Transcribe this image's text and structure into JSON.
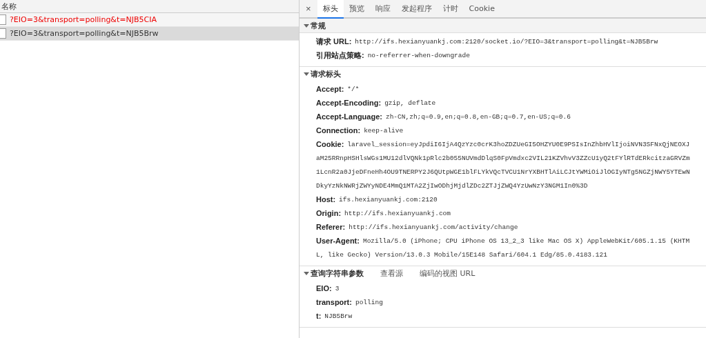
{
  "requests": {
    "column_header": "名称",
    "rows": [
      {
        "name": "?EIO=3&transport=polling&t=NJB5CIA",
        "failed": true,
        "selected": false
      },
      {
        "name": "?EIO=3&transport=polling&t=NJB5Brw",
        "failed": false,
        "selected": true
      }
    ]
  },
  "detail": {
    "close": "×",
    "tabs": [
      {
        "label": "标头",
        "selected": true
      },
      {
        "label": "预览",
        "selected": false
      },
      {
        "label": "响应",
        "selected": false
      },
      {
        "label": "发起程序",
        "selected": false
      },
      {
        "label": "计时",
        "selected": false
      },
      {
        "label": "Cookie",
        "selected": false
      }
    ],
    "sections": [
      {
        "title": "常规",
        "expanded": true,
        "header_bg": true,
        "entries": [
          {
            "key": "请求 URL:",
            "lines": [
              "http://ifs.hexianyuankj.com:2120/socket.io/?EIO=3&transport=polling&t=NJB5Brw"
            ]
          },
          {
            "key": "引用站点策略:",
            "lines": [
              "no-referrer-when-downgrade"
            ]
          }
        ]
      },
      {
        "title": "请求标头",
        "expanded": true,
        "header_bg": false,
        "entries": [
          {
            "key": "Accept:",
            "lines": [
              "*/*"
            ]
          },
          {
            "key": "Accept-Encoding:",
            "lines": [
              "gzip, deflate"
            ]
          },
          {
            "key": "Accept-Language:",
            "lines": [
              "zh-CN,zh;q=0.9,en;q=0.8,en-GB;q=0.7,en-US;q=0.6"
            ]
          },
          {
            "key": "Connection:",
            "lines": [
              "keep-alive"
            ]
          },
          {
            "key": "Cookie:",
            "lines": [
              "laravel_session=eyJpdiI6IjA4QzYzc0crK3hoZDZUeGI5OHZYU0E9PSIsInZhbHVlIjoiNVN3SFNxQjNEOXJ",
              "aM25RRnpHSHlsWGs1MU12dlVQNk1pRlc2b055NUVmdDlqS0FpVmdxc2VIL21KZVhvV3ZZcU1yQ2tFYlRTdERkcitzaGRVZm",
              "1LcnR2a0JjeDFneHh4OU9TNERPY2J6QUtpWGE1blFLYkVQcTVCU1NrYXBHTlAiLCJtYWMiOiJlOGIyNTg5NGZjNWY5YTEwN",
              "DkyYzNkNWRjZWYyNDE4MmQ1MTA2ZjIwODhjMjdlZDc2ZTJjZWQ4YzUwNzY3NGM1In0%3D"
            ]
          },
          {
            "key": "Host:",
            "lines": [
              "ifs.hexianyuankj.com:2120"
            ]
          },
          {
            "key": "Origin:",
            "lines": [
              "http://ifs.hexianyuankj.com"
            ]
          },
          {
            "key": "Referer:",
            "lines": [
              "http://ifs.hexianyuankj.com/activity/change"
            ]
          },
          {
            "key": "User-Agent:",
            "lines": [
              "Mozilla/5.0 (iPhone; CPU iPhone OS 13_2_3 like Mac OS X) AppleWebKit/605.1.15 (KHTM",
              "L, like Gecko) Version/13.0.3 Mobile/15E148 Safari/604.1 Edg/85.0.4183.121"
            ]
          }
        ]
      },
      {
        "title": "查询字符串参数",
        "expanded": true,
        "header_bg": false,
        "links": [
          "查看源",
          "编码的视图 URL"
        ],
        "entries": [
          {
            "key": "EIO:",
            "lines": [
              "3"
            ]
          },
          {
            "key": "transport:",
            "lines": [
              "polling"
            ]
          },
          {
            "key": "t:",
            "lines": [
              "NJB5Brw"
            ]
          }
        ]
      }
    ]
  }
}
